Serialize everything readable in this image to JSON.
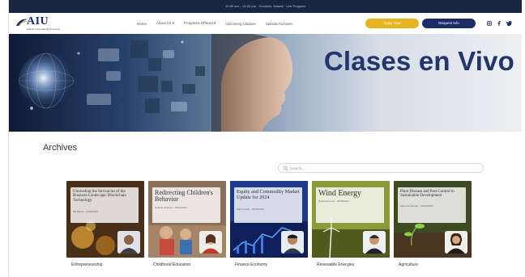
{
  "topbar": {
    "text": "10:00 am – 01:00 pm · Honolulu, Hawaii · Live Program"
  },
  "nav": {
    "logo_text": "AIU",
    "logo_sub": "Atlantic International University",
    "menu": [
      "Home",
      "About Us ▾",
      "Programs Offered ▾",
      "Upcoming Classes",
      "Special Archives"
    ],
    "apply_label": "Apply Now",
    "info_label": "Request Info",
    "social": [
      "instagram-icon",
      "facebook-icon",
      "twitter-icon"
    ]
  },
  "hero": {
    "title": "Clases en Vivo"
  },
  "archives": {
    "title": "Archives",
    "search_placeholder": "Search...",
    "cards": [
      {
        "title": "Unraveling the Intricacies of the Business Landscape: Blockchain Technology",
        "sub": "Bill Farrell · 11/30/2023",
        "label": "Entrepreneurship",
        "bg": "#5a3a1e"
      },
      {
        "title": "Redirecting Children's Behavior",
        "sub": "Cristina Jiménez · 03/14/2024",
        "label": "Childhood Education",
        "bg": "#8a6f5a"
      },
      {
        "title": "Equity and Commodity Market Update for 2024",
        "sub": "Mario Prado · 02/28/2024",
        "label": "Finance Economy",
        "bg": "#1d3a8c"
      },
      {
        "title": "Wind Energy",
        "sub": "Robertson Luis · 02/28/2024",
        "label": "Renewable Energies",
        "bg": "#6d7a2a"
      },
      {
        "title": "Plant Disease and Pest Control in Sustainable Development",
        "sub": "Maria Fernandez · 02/29/2024",
        "label": "Agriculture",
        "bg": "#3d4a22"
      }
    ]
  },
  "colors": {
    "navy": "#1b2e6b",
    "gold": "#e6b51d",
    "hero_title": "#22356e"
  }
}
